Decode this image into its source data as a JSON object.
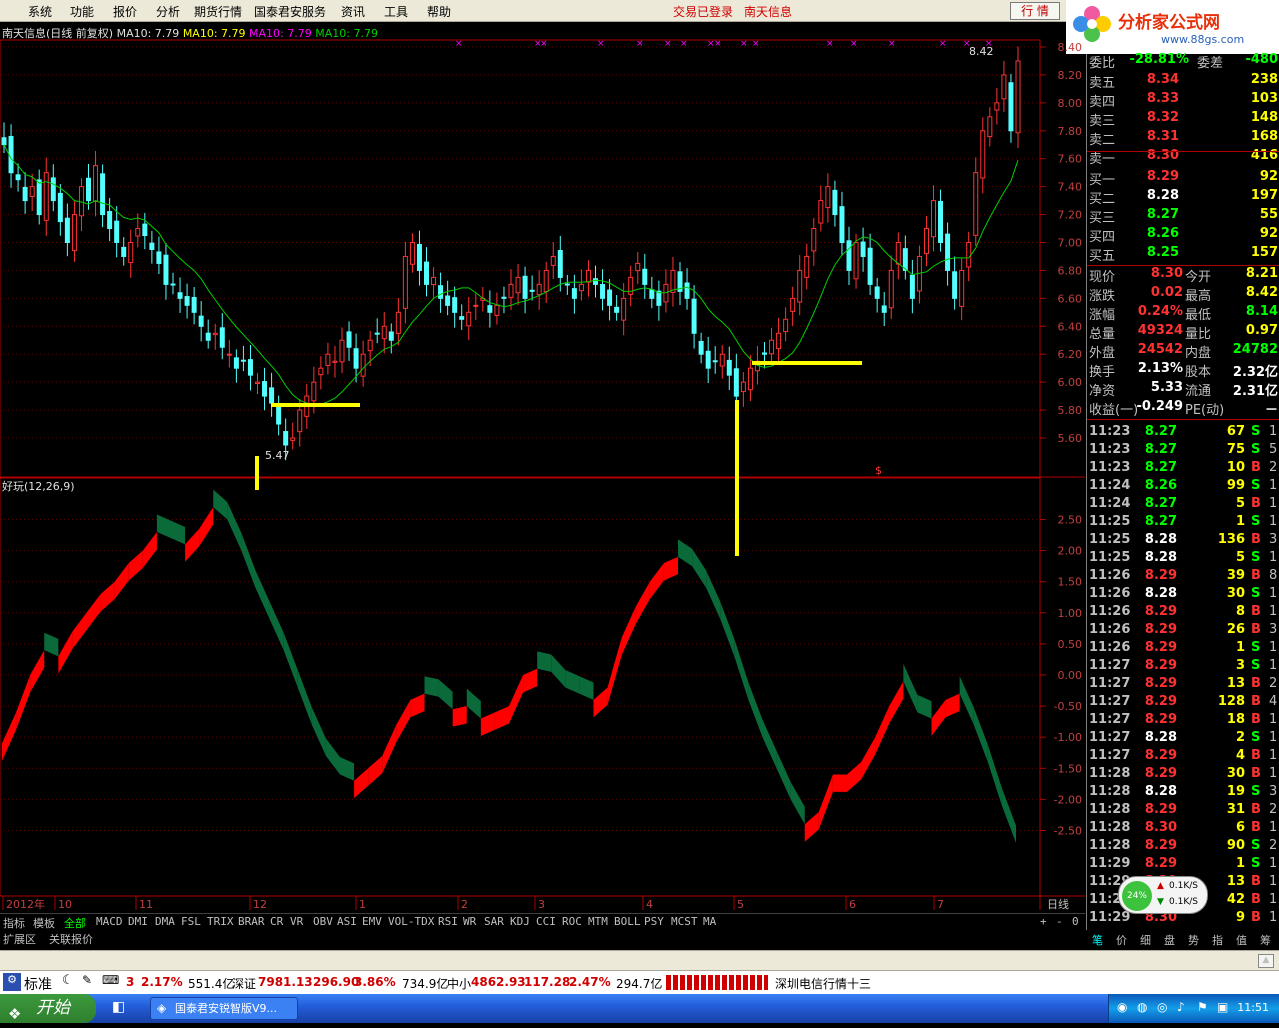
{
  "menu": {
    "items": [
      "系统",
      "功能",
      "报价",
      "分析",
      "期货行情",
      "国泰君安服务",
      "资讯",
      "工具",
      "帮助"
    ],
    "trade_status": "交易已登录",
    "stock_name": "南天信息",
    "quote_button": "行 情"
  },
  "logo": {
    "text": "分析家公式网",
    "url": "www.88gs.com"
  },
  "chart": {
    "title": "南天信息(日线 前复权)",
    "ma1": "MA10: 7.79",
    "ma2": "MA10: 7.79",
    "ma3": "MA10: 7.79",
    "ma4": "MA10: 7.79",
    "high_label": "8.42",
    "low_label": "5.47",
    "price_ticks": [
      "8.40",
      "8.20",
      "8.00",
      "7.80",
      "7.60",
      "7.40",
      "7.20",
      "7.00",
      "6.80",
      "6.60",
      "6.40",
      "6.20",
      "6.00",
      "5.80",
      "5.60"
    ],
    "indicator_title": "好玩(12,26,9)",
    "ind_ticks": [
      "2.50",
      "2.00",
      "1.50",
      "1.00",
      "0.50",
      "0.00",
      "-0.50",
      "-1.00",
      "-1.50",
      "-2.00",
      "-2.50"
    ],
    "x_labels": [
      "2012年",
      "10",
      "11",
      "12",
      "1",
      "2",
      "3",
      "4",
      "5",
      "6",
      "7"
    ],
    "period": "日线",
    "colors": {
      "up": "#ff3232",
      "down": "#54ffff",
      "ma": "#00d000",
      "osc_up": "#ff0000",
      "osc_down": "#0a6a3a",
      "marker": "#ffff00"
    }
  },
  "tabs": {
    "items": [
      "指标",
      "模板",
      "全部",
      "MACD",
      "DMI",
      "DMA",
      "FSL",
      "TRIX",
      "BRAR",
      "CR",
      "VR",
      "OBV",
      "ASI",
      "EMV",
      "VOL-TDX",
      "RSI",
      "WR",
      "SAR",
      "KDJ",
      "CCI",
      "ROC",
      "MTM",
      "BOLL",
      "PSY",
      "MCST",
      "MA"
    ],
    "extra": [
      "扩展区",
      "关联报价"
    ],
    "controls": [
      "+",
      "-",
      "0"
    ]
  },
  "quote": {
    "header": {
      "label1": "委比",
      "value1": "-28.81%",
      "label2": "委差",
      "value2": "-480"
    },
    "sells": [
      {
        "label": "卖五",
        "price": "8.34",
        "vol": "238"
      },
      {
        "label": "卖四",
        "price": "8.33",
        "vol": "103"
      },
      {
        "label": "卖三",
        "price": "8.32",
        "vol": "148"
      },
      {
        "label": "卖二",
        "price": "8.31",
        "vol": "168"
      },
      {
        "label": "卖一",
        "price": "8.30",
        "vol": "416"
      }
    ],
    "buys": [
      {
        "label": "买一",
        "price": "8.29",
        "vol": "92"
      },
      {
        "label": "买二",
        "price": "8.28",
        "vol": "197"
      },
      {
        "label": "买三",
        "price": "8.27",
        "vol": "55"
      },
      {
        "label": "买四",
        "price": "8.26",
        "vol": "92"
      },
      {
        "label": "买五",
        "price": "8.25",
        "vol": "157"
      }
    ],
    "stats": [
      {
        "l1": "现价",
        "v1": "8.30",
        "l2": "今开",
        "v2": "8.21"
      },
      {
        "l1": "涨跌",
        "v1": "0.02",
        "l2": "最高",
        "v2": "8.42"
      },
      {
        "l1": "涨幅",
        "v1": "0.24%",
        "l2": "最低",
        "v2": "8.14"
      },
      {
        "l1": "总量",
        "v1": "49324",
        "l2": "量比",
        "v2": "0.97"
      },
      {
        "l1": "外盘",
        "v1": "24542",
        "l2": "内盘",
        "v2": "24782"
      },
      {
        "l1": "换手",
        "v1": "2.13%",
        "l2": "股本",
        "v2": "2.32亿"
      },
      {
        "l1": "净资",
        "v1": "5.33",
        "l2": "流通",
        "v2": "2.31亿"
      },
      {
        "l1": "收益(一)",
        "v1": "-0.249",
        "l2": "PE(动)",
        "v2": "－"
      }
    ]
  },
  "trades": [
    {
      "t": "11:23",
      "p": "8.27",
      "v": "67",
      "bs": "S",
      "n": "1"
    },
    {
      "t": "11:23",
      "p": "8.27",
      "v": "75",
      "bs": "S",
      "n": "5"
    },
    {
      "t": "11:23",
      "p": "8.27",
      "v": "10",
      "bs": "B",
      "n": "2"
    },
    {
      "t": "11:24",
      "p": "8.26",
      "v": "99",
      "bs": "S",
      "n": "1"
    },
    {
      "t": "11:24",
      "p": "8.27",
      "v": "5",
      "bs": "B",
      "n": "1"
    },
    {
      "t": "11:25",
      "p": "8.27",
      "v": "1",
      "bs": "S",
      "n": "1"
    },
    {
      "t": "11:25",
      "p": "8.28",
      "v": "136",
      "bs": "B",
      "n": "3"
    },
    {
      "t": "11:25",
      "p": "8.28",
      "v": "5",
      "bs": "S",
      "n": "1"
    },
    {
      "t": "11:26",
      "p": "8.29",
      "v": "39",
      "bs": "B",
      "n": "8"
    },
    {
      "t": "11:26",
      "p": "8.28",
      "v": "30",
      "bs": "S",
      "n": "1"
    },
    {
      "t": "11:26",
      "p": "8.29",
      "v": "8",
      "bs": "B",
      "n": "1"
    },
    {
      "t": "11:26",
      "p": "8.29",
      "v": "26",
      "bs": "B",
      "n": "3"
    },
    {
      "t": "11:26",
      "p": "8.29",
      "v": "1",
      "bs": "S",
      "n": "1"
    },
    {
      "t": "11:27",
      "p": "8.29",
      "v": "3",
      "bs": "S",
      "n": "1"
    },
    {
      "t": "11:27",
      "p": "8.29",
      "v": "13",
      "bs": "B",
      "n": "2"
    },
    {
      "t": "11:27",
      "p": "8.29",
      "v": "128",
      "bs": "B",
      "n": "4"
    },
    {
      "t": "11:27",
      "p": "8.29",
      "v": "18",
      "bs": "B",
      "n": "1"
    },
    {
      "t": "11:27",
      "p": "8.28",
      "v": "2",
      "bs": "S",
      "n": "1"
    },
    {
      "t": "11:27",
      "p": "8.29",
      "v": "4",
      "bs": "B",
      "n": "1"
    },
    {
      "t": "11:28",
      "p": "8.29",
      "v": "30",
      "bs": "B",
      "n": "1"
    },
    {
      "t": "11:28",
      "p": "8.28",
      "v": "19",
      "bs": "S",
      "n": "3"
    },
    {
      "t": "11:28",
      "p": "8.29",
      "v": "31",
      "bs": "B",
      "n": "2"
    },
    {
      "t": "11:28",
      "p": "8.30",
      "v": "6",
      "bs": "B",
      "n": "1"
    },
    {
      "t": "11:28",
      "p": "8.29",
      "v": "90",
      "bs": "S",
      "n": "2"
    },
    {
      "t": "11:29",
      "p": "8.29",
      "v": "1",
      "bs": "S",
      "n": "1"
    },
    {
      "t": "11:29",
      "p": "8.29",
      "v": "13",
      "bs": "B",
      "n": "1"
    },
    {
      "t": "11:29",
      "p": "8.29",
      "v": "42",
      "bs": "B",
      "n": "1"
    },
    {
      "t": "11:29",
      "p": "8.30",
      "v": "9",
      "bs": "B",
      "n": "1"
    }
  ],
  "bottom_tabs": [
    "笔",
    "价",
    "细",
    "盘",
    "势",
    "指",
    "值",
    "筹"
  ],
  "net_widget": {
    "percent": "24%",
    "up": "0.1K/S",
    "down": "0.1K/S"
  },
  "index_bar": {
    "std": "标准",
    "i1": "3",
    "i1pct": "2.17%",
    "i1amt": "551.4亿",
    "i2name": "深证",
    "i2val": "7981.13",
    "i2chg": "296.90",
    "i2pct": "3.86%",
    "i2amt": "734.9亿",
    "i3name": "中小",
    "i3val": "4862.93",
    "i3chg": "117.28",
    "i3pct": "2.47%",
    "i3amt": "294.7亿",
    "news": "深圳电信行情十三"
  },
  "taskbar": {
    "start": "开始",
    "task": "国泰君安锐智版V9...",
    "clock": "11:51"
  }
}
